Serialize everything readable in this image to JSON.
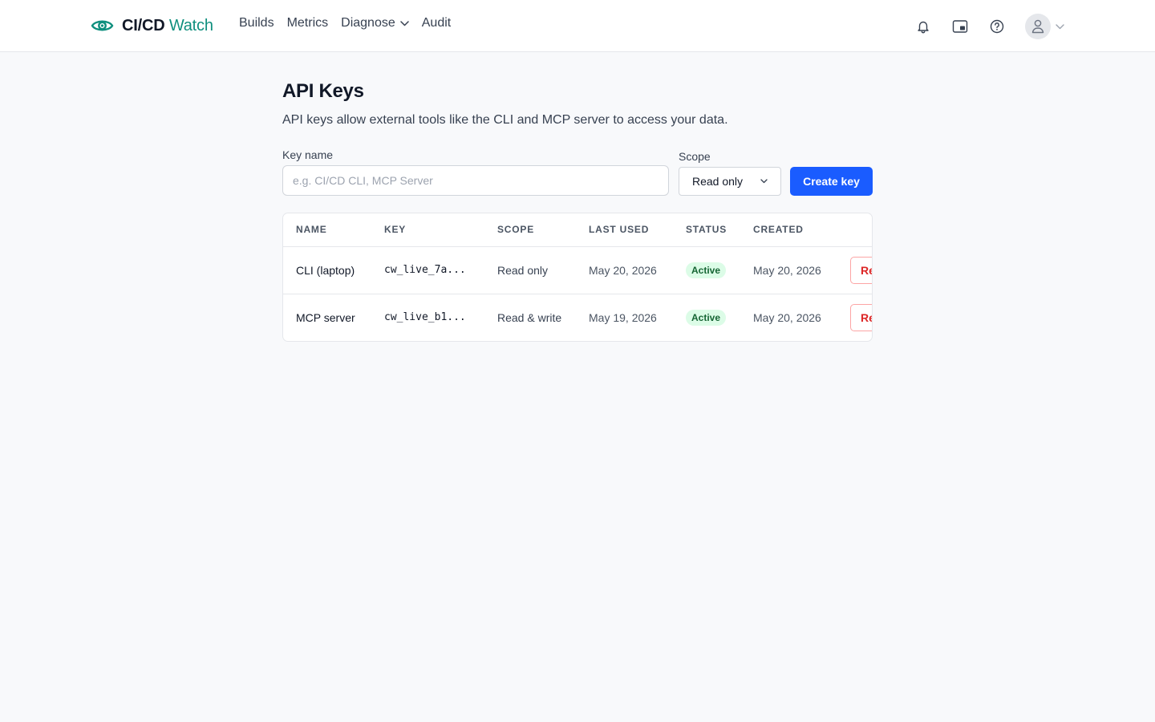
{
  "app": {
    "brand_strong": "CI/CD",
    "brand_accent": "Watch",
    "accent_color": "#0f8f7e",
    "logo_icon": "eye-icon"
  },
  "nav": {
    "items": [
      {
        "label": "Builds"
      },
      {
        "label": "Metrics"
      },
      {
        "label": "Diagnose",
        "has_dropdown": true
      },
      {
        "label": "Audit"
      }
    ]
  },
  "header_icons": [
    "bell-icon",
    "picture-in-picture-icon",
    "help-icon",
    "user-avatar-icon"
  ],
  "page": {
    "title": "API Keys",
    "description": "API keys allow external tools like the CLI and MCP server to access your data."
  },
  "form": {
    "key_name_label": "Key name",
    "key_name_value": "",
    "key_name_placeholder": "e.g. CI/CD CLI, MCP Server",
    "scope_label": "Scope",
    "scope_selected": "Read only",
    "create_button": "Create key",
    "primary_color": "#1a5cff"
  },
  "table": {
    "headers": {
      "name": "NAME",
      "key": "KEY",
      "scope": "SCOPE",
      "last_used": "LAST USED",
      "status": "STATUS",
      "created": "CREATED"
    },
    "rows": [
      {
        "name": "CLI (laptop)",
        "key": "cw_live_7a...",
        "scope": "Read only",
        "last_used": "May 20, 2026",
        "status": "Active",
        "created": "May 20, 2026",
        "action": "Revoke"
      },
      {
        "name": "MCP server",
        "key": "cw_live_b1...",
        "scope": "Read & write",
        "last_used": "May 19, 2026",
        "status": "Active",
        "created": "May 20, 2026",
        "action": "Revoke"
      }
    ],
    "status_active_color": "#166534",
    "revoke_color": "#dc2626"
  }
}
